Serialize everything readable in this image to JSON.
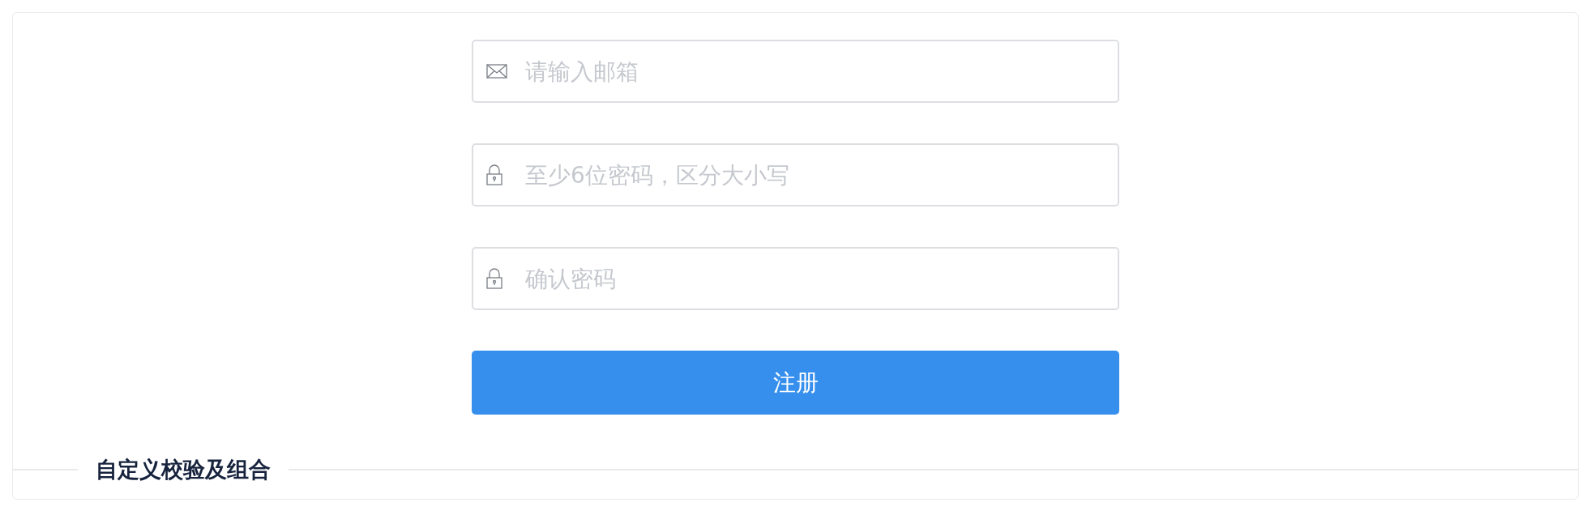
{
  "fields": [
    {
      "kind": "email",
      "placeholder": "请输入邮箱"
    },
    {
      "kind": "password",
      "placeholder": "至少6位密码，区分大小写"
    },
    {
      "kind": "password",
      "placeholder": "确认密码"
    }
  ],
  "submit_button": "注册",
  "divider_title": "自定义校验及组合"
}
